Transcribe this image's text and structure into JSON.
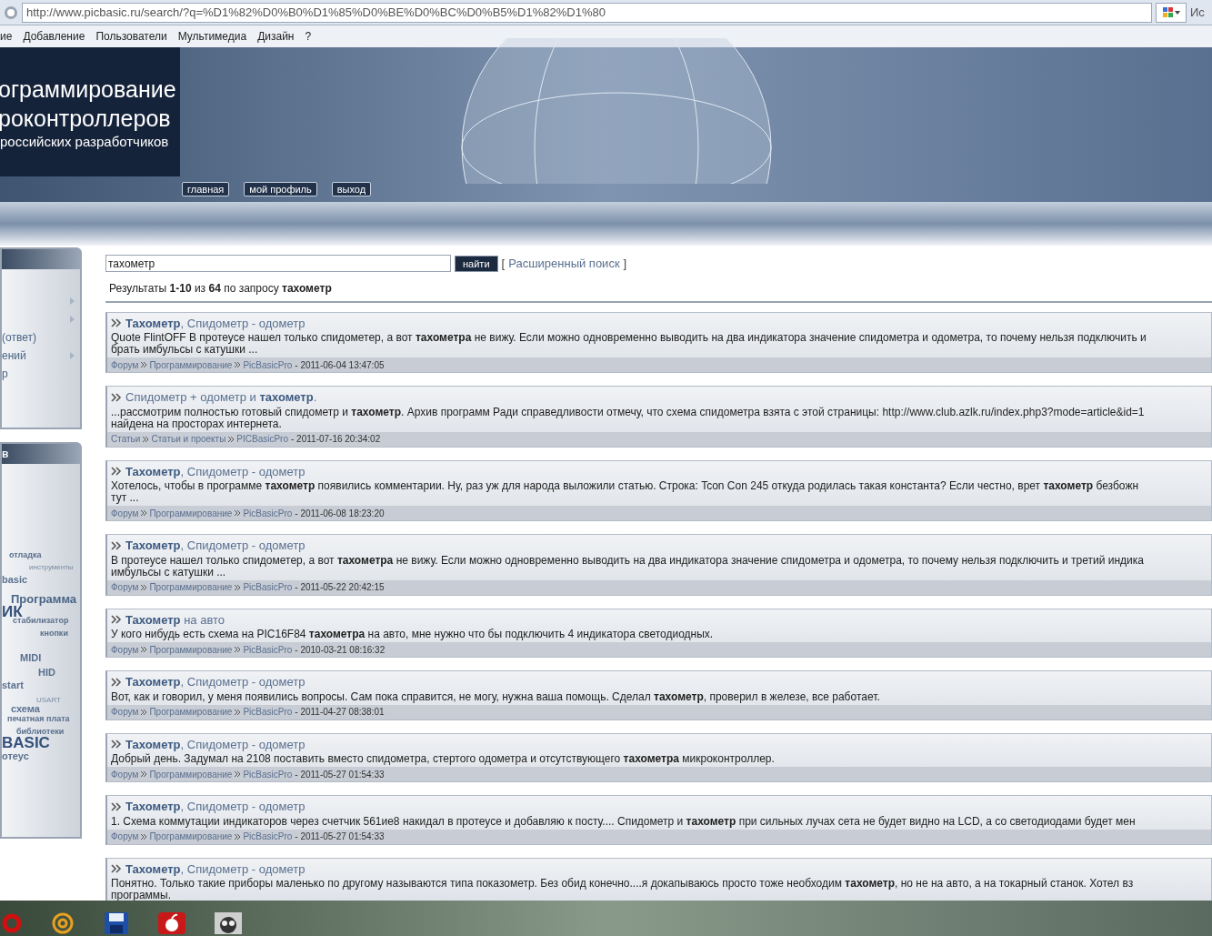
{
  "browser": {
    "url": "http://www.picbasic.ru/search/?q=%D1%82%D0%B0%D1%85%D0%BE%D0%BC%D0%B5%D1%82%D1%80",
    "search_text": "Ис"
  },
  "menu": [
    "ие",
    "Добавление",
    "Пользователи",
    "Мультимедиа",
    "Дизайн",
    "?"
  ],
  "header": {
    "title_lines": [
      "ограммирование",
      "роконтроллеров"
    ],
    "subtitle": "российских разработчиков",
    "buttons": [
      "главная",
      "мой профиль",
      "выход"
    ]
  },
  "sidebar": {
    "panels": [
      {
        "items": [
          {
            "submenu": true
          },
          {
            "submenu": true
          },
          {
            "label": "(ответ)",
            "submenu": false
          },
          {
            "label": "ений",
            "submenu": true
          },
          {
            "label": "р",
            "submenu": false
          }
        ]
      },
      {
        "title": "в"
      }
    ],
    "tags": [
      {
        "text": "отладка",
        "kind": "small"
      },
      {
        "text": "инструменты",
        "kind": "tiny"
      },
      {
        "text": "basic",
        "kind": "medium"
      },
      {
        "text": "Программа",
        "kind": "large"
      },
      {
        "text": "ИК",
        "kind": "huge"
      },
      {
        "text": "стабилизатор",
        "kind": "small"
      },
      {
        "text": "кнопки",
        "kind": "small"
      },
      {
        "text": "MIDI",
        "kind": "medium"
      },
      {
        "text": "HID",
        "kind": "medium"
      },
      {
        "text": "start",
        "kind": "medium"
      },
      {
        "text": "USART",
        "kind": "tiny"
      },
      {
        "text": "схема",
        "kind": "medium"
      },
      {
        "text": "печатная плата",
        "kind": "small"
      },
      {
        "text": "библиотеки",
        "kind": "small"
      },
      {
        "text": "BASIC",
        "kind": "huge"
      },
      {
        "text": "отеус",
        "kind": "medium"
      }
    ]
  },
  "search": {
    "value": "тахометр",
    "button": "найти",
    "advanced_open": "[",
    "advanced_link": "Расширенный поиск",
    "advanced_close": "]",
    "summary": "Результаты **1-10** из **64** по запросу **тахометр**"
  },
  "results": [
    {
      "title": "**Тахометр**, Спидометр - одометр",
      "lines": [
        "Quote FlintOFF В протеусе нашел только спидометер, а вот **тахометра** не вижу. Если можно одновременно выводить на два индикатора значение спидометра и одометра, то почему нельзя подключить и",
        "брать имбульсы с катушки ..."
      ],
      "crumbs": [
        "Форум",
        "Программирование",
        "PicBasicPro"
      ],
      "date": "- 2011-06-04 13:47:05"
    },
    {
      "title": "Спидометр + одометр и **тахометр**.",
      "lines": [
        "...рассмотрим полностью готовый спидометр и **тахометр**. Архив программ Ради справедливости отмечу, что схема спидометра взята с этой страницы: http://www.club.azlk.ru/index.php3?mode=article&id=1",
        "найдена на просторах интернета."
      ],
      "crumbs": [
        "Статьи",
        "Статьи и проекты",
        "PICBasicPro"
      ],
      "date": "- 2011-07-16 20:34:02"
    },
    {
      "title": "**Тахометр**, Спидометр - одометр",
      "lines": [
        "Хотелось, чтобы в программе **тахометр** появились комментарии. Ну, раз уж для народа выложили статью. Строка: Tcon Con 245 откуда родилась такая константа? Если честно, врет **тахометр** безбожн",
        "тут ..."
      ],
      "crumbs": [
        "Форум",
        "Программирование",
        "PicBasicPro"
      ],
      "date": "- 2011-06-08 18:23:20"
    },
    {
      "title": "**Тахометр**, Спидометр - одометр",
      "lines": [
        "В протеусе нашел только спидометер, а вот **тахометра** не вижу. Если можно одновременно выводить на два индикатора значение спидометра и одометра, то почему нельзя подключить и третий индика",
        "имбульсы с катушки ..."
      ],
      "crumbs": [
        "Форум",
        "Программирование",
        "PicBasicPro"
      ],
      "date": "- 2011-05-22 20:42:15"
    },
    {
      "title": "**Тахометр** на авто",
      "lines": [
        "У кого нибудь есть схема на PIC16F84 **тахометра** на авто, мне нужно что бы подключить 4 индикатора светодиодных."
      ],
      "crumbs": [
        "Форум",
        "Программирование",
        "PicBasicPro"
      ],
      "date": "- 2010-03-21 08:16:32"
    },
    {
      "title": "**Тахометр**, Спидометр - одометр",
      "lines": [
        "Вот, как и говорил, у меня появились вопросы. Сам пока справится, не могу, нужна ваша помощь. Сделал **тахометр**, проверил в железе, все работает."
      ],
      "crumbs": [
        "Форум",
        "Программирование",
        "PicBasicPro"
      ],
      "date": "- 2011-04-27 08:38:01"
    },
    {
      "title": "**Тахометр**, Спидометр - одометр",
      "lines": [
        "Добрый день. Задумал на 2108 поставить вместо спидометра, стертого одометра и отсутствующего **тахометра** микроконтроллер."
      ],
      "crumbs": [
        "Форум",
        "Программирование",
        "PicBasicPro"
      ],
      "date": "- 2011-05-27 01:54:33"
    },
    {
      "title": "**Тахометр**, Спидометр - одометр",
      "lines": [
        "1. Схема коммутации индикаторов через счетчик 561ие8 накидал в протеусе и добавляю к посту.... Спидометр и **тахометр** при сильных лучах сета не будет видно на LCD, а со светодиодами будет мен"
      ],
      "crumbs": [
        "Форум",
        "Программирование",
        "PicBasicPro"
      ],
      "date": "- 2011-05-27 01:54:33"
    },
    {
      "title": "**Тахометр**, Спидометр - одометр",
      "lines": [
        "Понятно. Только такие приборы маленько по другому называются типа показометр. Без обид конечно....я докапываюсь просто тоже необходим **тахометр**, но не на авто, а на токарный станок. Хотел вз",
        "программы."
      ]
    }
  ],
  "taskbar": {
    "buttons": [
      {
        "kind": "opera"
      },
      {
        "kind": "at"
      },
      {
        "kind": "floppy"
      },
      {
        "kind": "apple"
      },
      {
        "kind": "owl"
      }
    ]
  }
}
